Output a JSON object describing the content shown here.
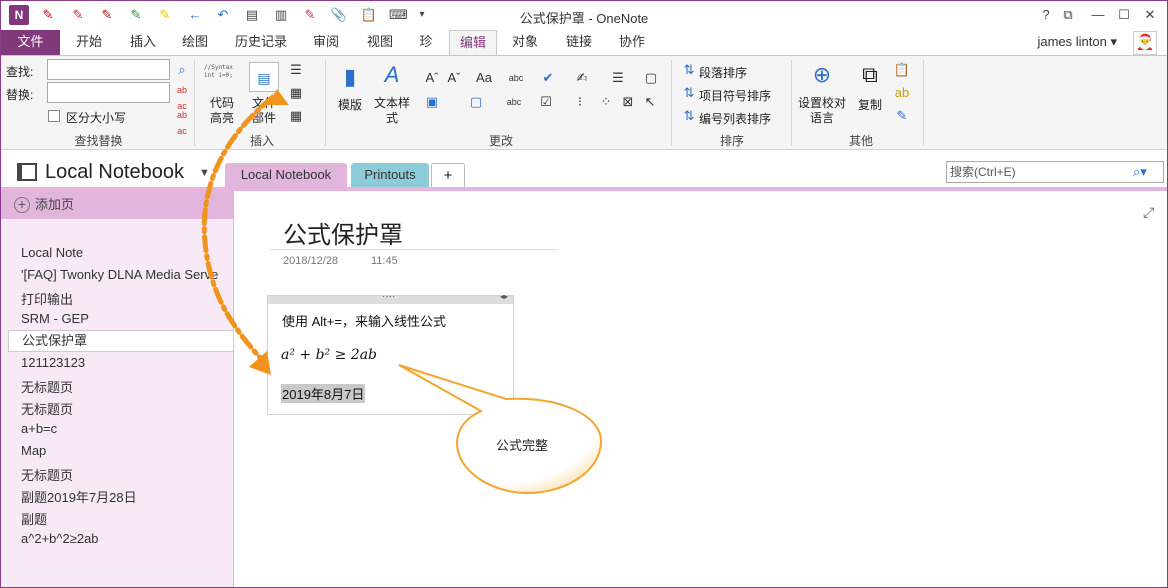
{
  "window": {
    "title": "公式保护罩 - OneNote",
    "controls": [
      "?",
      "⧉",
      "—",
      "☐",
      "✕"
    ]
  },
  "quick_access": [
    "←",
    "↶",
    "▤",
    "▥",
    "✎",
    "📎",
    "📋",
    "⌨",
    "▾"
  ],
  "tabs": [
    "文件",
    "开始",
    "插入",
    "绘图",
    "历史记录",
    "审阅",
    "视图",
    "珍",
    "编辑",
    "对象",
    "链接",
    "协作"
  ],
  "active_tab": "编辑",
  "user": {
    "name": "james linton ▾"
  },
  "ribbon": {
    "find_replace": {
      "find_label": "查找:",
      "replace_label": "替换:",
      "case_label": "区分大小写",
      "group_label": "查找替换"
    },
    "insert": {
      "code_label": "代码\n高亮",
      "file_label": "文件\n部件",
      "code_preview": "//Syntax\nint i=0;",
      "group_label": "插入"
    },
    "change": {
      "template_label": "模版",
      "textstyle_label": "文本样\n式",
      "group_label": "更改"
    },
    "sort": {
      "para_sort": "段落排序",
      "bullet_sort": "项目符号排序",
      "number_sort": "编号列表排序",
      "group_label": "排序"
    },
    "other": {
      "lang_label": "设置校对\n语言",
      "copy_label": "复制",
      "group_label": "其他"
    }
  },
  "notebook": {
    "name": "Local Notebook",
    "sections": [
      "Local Notebook",
      "Printouts",
      "+"
    ],
    "search_placeholder": "搜索(Ctrl+E)"
  },
  "sidebar": {
    "add_page": "添加页",
    "pages": [
      "Local Note",
      "'[FAQ] Twonky DLNA Media Serve",
      "打印输出",
      "SRM - GEP",
      "公式保护罩",
      "121123123",
      "无标题页",
      "无标题页",
      "a+b=c",
      "Map",
      "无标题页",
      "副题2019年7月28日",
      "副题",
      "a^2+b^2≥2ab"
    ],
    "selected_index": 4
  },
  "page": {
    "title": "公式保护罩",
    "date": "2018/12/28",
    "time": "11:45",
    "line1": "使用 Alt+=，来输入线性公式",
    "formula": "a² + b² ≥ 2ab",
    "date_text": "2019年8月7日",
    "callout": "公式完整"
  },
  "colors": {
    "accent": "#80397b",
    "sidebar_bg": "#f7e9f5",
    "callout_fill": "#ffffff",
    "callout_stroke": "#f2a533",
    "arrow": "#f0941e"
  }
}
